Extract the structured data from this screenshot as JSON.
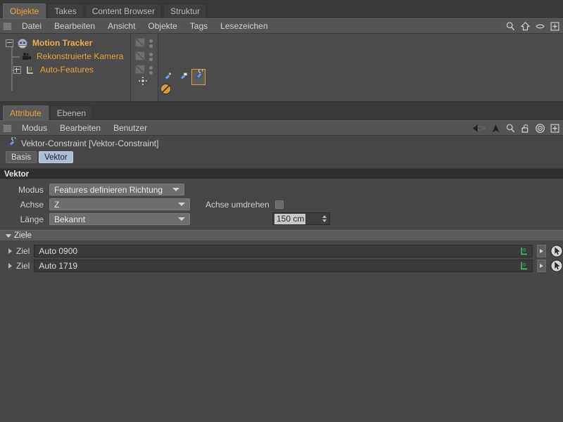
{
  "object_manager": {
    "tabs": [
      {
        "label": "Objekte",
        "active": true
      },
      {
        "label": "Takes",
        "active": false
      },
      {
        "label": "Content Browser",
        "active": false
      },
      {
        "label": "Struktur",
        "active": false
      }
    ],
    "menu": [
      "Datei",
      "Bearbeiten",
      "Ansicht",
      "Objekte",
      "Tags",
      "Lesezeichen"
    ],
    "menu_icons": [
      "search-icon",
      "home-icon",
      "eye-icon",
      "plus-box-icon"
    ],
    "objects": [
      {
        "name": "Motion Tracker",
        "icon": "motion-tracker-icon",
        "selected": true,
        "expander": "minus",
        "depth": 0
      },
      {
        "name": "Rekonstruierte Kamera",
        "icon": "camera-icon",
        "selected": false,
        "expander": "none",
        "depth": 1
      },
      {
        "name": "Auto-Features",
        "icon": "l0-feature-icon",
        "selected": false,
        "expander": "plus",
        "depth": 1
      }
    ],
    "tags": [
      {
        "name": "vector-constraint-tag-add",
        "selected": false
      },
      {
        "name": "vector-constraint-tag",
        "selected": false
      },
      {
        "name": "vector-constraint-tag-active",
        "selected": true
      }
    ],
    "row_extra_icons": [
      "axis-move-icon",
      "no-entry-icon"
    ]
  },
  "attribute_manager": {
    "tabs": [
      {
        "label": "Attribute",
        "active": true
      },
      {
        "label": "Ebenen",
        "active": false
      }
    ],
    "menu": [
      "Modus",
      "Bearbeiten",
      "Benutzer"
    ],
    "menu_icons": [
      "back-arrow-icon",
      "up-arrow-icon",
      "search-icon",
      "unlock-icon",
      "target-icon",
      "plus-box-icon"
    ],
    "object_title": "Vektor-Constraint [Vektor-Constraint]",
    "object_title_icon": "vector-constraint-icon",
    "param_tabs": [
      {
        "label": "Basis",
        "active": false
      },
      {
        "label": "Vektor",
        "active": true
      }
    ],
    "sections": {
      "vektor": {
        "header": "Vektor",
        "fields": {
          "modus": {
            "label": "Modus",
            "value": "Features definieren Richtung"
          },
          "achse": {
            "label": "Achse",
            "value": "Z"
          },
          "laenge": {
            "label": "Länge",
            "value": "Bekannt"
          },
          "achse_umdrehen": {
            "label": "Achse umdrehen",
            "checked": false
          },
          "laenge_wert": {
            "value": "150 cm",
            "selected": true
          }
        }
      },
      "ziele": {
        "header": "Ziele",
        "expanded": true,
        "rows": [
          {
            "label": "Ziel",
            "value": "Auto 0900",
            "badge": "L0"
          },
          {
            "label": "Ziel",
            "value": "Auto 1719",
            "badge": "L0"
          }
        ]
      }
    }
  },
  "colors": {
    "background": "#474747",
    "panel": "#4b4b4b",
    "accent_orange": "#e8a33b",
    "tab_active_blue": "#aebdd6",
    "section_header": "#2e2e2e",
    "badge_green": "#3fd06a",
    "tag_blue": "#7f96d4"
  }
}
